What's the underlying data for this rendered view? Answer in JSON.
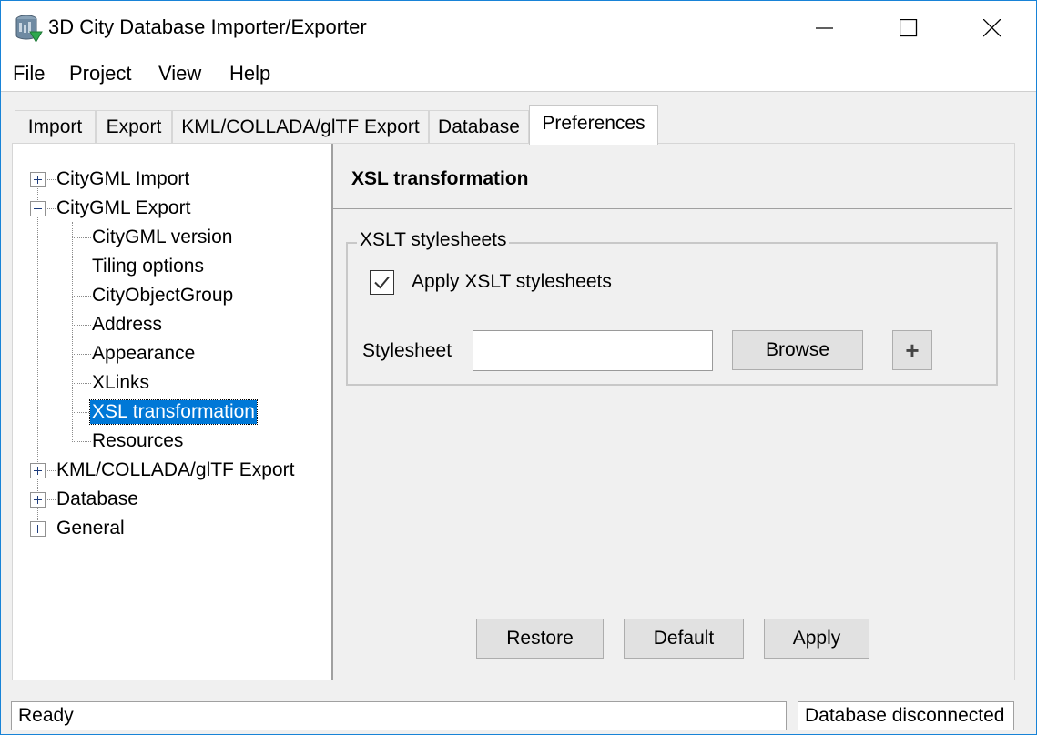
{
  "window": {
    "title": "3D City Database Importer/Exporter",
    "accent_color": "#1883d7"
  },
  "menu": [
    "File",
    "Project",
    "View",
    "Help"
  ],
  "tabs": [
    "Import",
    "Export",
    "KML/COLLADA/glTF Export",
    "Database",
    "Preferences"
  ],
  "active_tab": "Preferences",
  "tree": {
    "roots": [
      {
        "label": "CityGML Import",
        "expanded": false
      },
      {
        "label": "CityGML Export",
        "expanded": true,
        "children": [
          "CityGML version",
          "Tiling options",
          "CityObjectGroup",
          "Address",
          "Appearance",
          "XLinks",
          "XSL transformation",
          "Resources"
        ]
      },
      {
        "label": "KML/COLLADA/glTF Export",
        "expanded": false
      },
      {
        "label": "Database",
        "expanded": false
      },
      {
        "label": "General",
        "expanded": false
      }
    ],
    "selected": "XSL transformation",
    "selection_color": "#0078d7"
  },
  "pane": {
    "title": "XSL transformation",
    "group_title": "XSLT stylesheets",
    "apply_checkbox_label": "Apply XSLT stylesheets",
    "apply_checked": true,
    "stylesheet_label": "Stylesheet",
    "stylesheet_value": "",
    "browse_label": "Browse",
    "add_label": "+"
  },
  "actions": {
    "restore": "Restore",
    "default": "Default",
    "apply": "Apply"
  },
  "status": {
    "left": "Ready",
    "right": "Database disconnected"
  }
}
